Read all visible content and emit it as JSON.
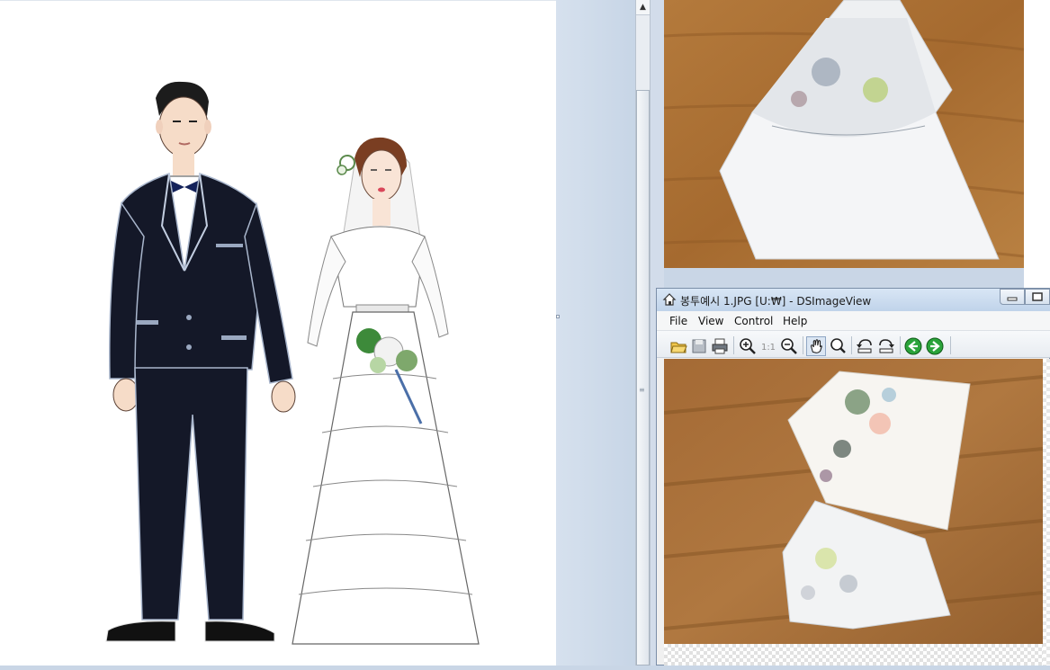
{
  "window": {
    "title": "봉투예시 1.JPG [U:₩] - DSImageView",
    "app_name": "DSImageView"
  },
  "menu": {
    "items": [
      {
        "label": "File"
      },
      {
        "label": "View"
      },
      {
        "label": "Control"
      },
      {
        "label": "Help"
      }
    ]
  },
  "toolbar": {
    "buttons": [
      {
        "name": "open-icon"
      },
      {
        "name": "save-icon"
      },
      {
        "name": "print-icon"
      },
      {
        "name": "zoom-in-icon"
      },
      {
        "name": "actual-size-icon",
        "label": "1:1"
      },
      {
        "name": "zoom-out-icon"
      },
      {
        "name": "hand-pan-icon",
        "pressed": true
      },
      {
        "name": "magnifier-icon"
      },
      {
        "name": "rotate-left-icon"
      },
      {
        "name": "rotate-right-icon"
      },
      {
        "name": "previous-image-icon"
      },
      {
        "name": "next-image-icon"
      }
    ]
  },
  "scrollbar": {
    "up_arrow": "▲",
    "grip": "≡"
  },
  "colors": {
    "title_bar": "#c8d9ee",
    "wood": "#a96a2e",
    "suit": "#141828",
    "accent_green": "#2aa33a"
  }
}
